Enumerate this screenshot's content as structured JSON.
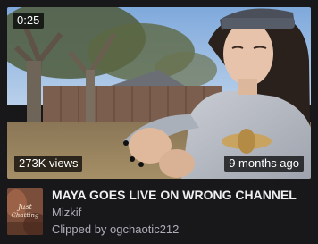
{
  "clip": {
    "duration": "0:25",
    "views": "273K views",
    "age": "9 months ago",
    "title": "MAYA GOES LIVE ON WRONG CHANNEL",
    "channel": "Mizkif",
    "clipped_by_prefix": "Clipped by ",
    "clipper": "ogchaotic212"
  },
  "avatar": {
    "lines": [
      "Just",
      "Chatting"
    ]
  },
  "colors": {
    "background": "#18181b",
    "title": "#efeff1",
    "secondary_text": "#adadb8",
    "badge_bg": "rgba(0,0,0,0.72)"
  }
}
